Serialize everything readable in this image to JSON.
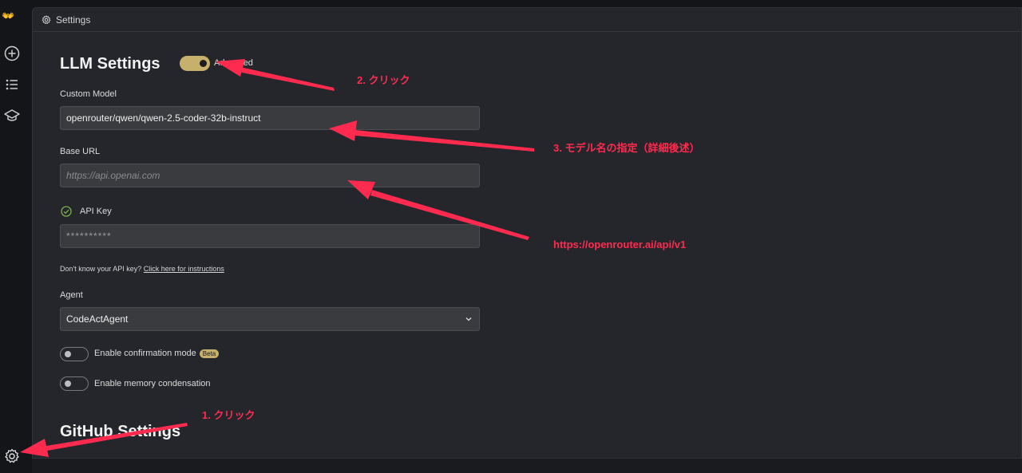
{
  "app": {
    "logo": "👐"
  },
  "header": {
    "title": "Settings"
  },
  "llm": {
    "title": "LLM Settings",
    "advanced_label": "Advanced",
    "advanced_on": true,
    "custom_model_label": "Custom Model",
    "custom_model_value": "openrouter/qwen/qwen-2.5-coder-32b-instruct",
    "base_url_label": "Base URL",
    "base_url_placeholder": "https://api.openai.com",
    "api_key_label": "API Key",
    "api_key_value": "**********",
    "help_text": "Don't know your API key?",
    "help_link": "Click here for instructions",
    "agent_label": "Agent",
    "agent_value": "CodeActAgent",
    "confirmation_label": "Enable confirmation mode",
    "beta_badge": "Beta",
    "memory_label": "Enable memory condensation"
  },
  "github": {
    "title": "GitHub Settings"
  },
  "annotations": {
    "step1": "1. クリック",
    "step2": "2. クリック",
    "step3": "3. モデル名の指定（詳細後述）",
    "url_note": "https://openrouter.ai/api/v1"
  },
  "colors": {
    "accent": "#c7b06c",
    "annotation": "#ff2b4e",
    "check": "#7fb04a"
  }
}
